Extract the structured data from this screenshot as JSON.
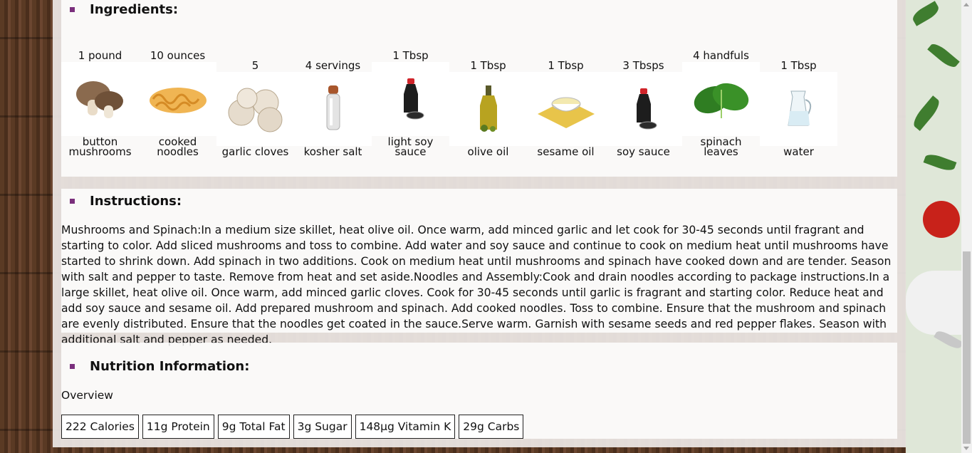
{
  "ingredients": {
    "title": "Ingredients:",
    "items": [
      {
        "qty": "1 pound",
        "name_line1": "button",
        "name_line2": "mushrooms",
        "icon": "mushroom-icon"
      },
      {
        "qty": "10 ounces",
        "name_line1": "cooked",
        "name_line2": "noodles",
        "icon": "noodles-icon"
      },
      {
        "qty": "5",
        "name_line1": "garlic cloves",
        "name_line2": "",
        "icon": "garlic-icon"
      },
      {
        "qty": "4 servings",
        "name_line1": "kosher salt",
        "name_line2": "",
        "icon": "salt-grinder-icon"
      },
      {
        "qty": "1 Tbsp",
        "name_line1": "light soy",
        "name_line2": "sauce",
        "icon": "soy-sauce-bottle-icon"
      },
      {
        "qty": "1 Tbsp",
        "name_line1": "olive oil",
        "name_line2": "",
        "icon": "olive-oil-bottle-icon"
      },
      {
        "qty": "1 Tbsp",
        "name_line1": "sesame oil",
        "name_line2": "",
        "icon": "sesame-oil-bowl-icon"
      },
      {
        "qty": "3 Tbsps",
        "name_line1": "soy sauce",
        "name_line2": "",
        "icon": "soy-sauce-bottle-icon"
      },
      {
        "qty": "4 handfuls",
        "name_line1": "spinach",
        "name_line2": "leaves",
        "icon": "spinach-icon"
      },
      {
        "qty": "1 Tbsp",
        "name_line1": "water",
        "name_line2": "",
        "icon": "water-jug-icon"
      }
    ]
  },
  "instructions": {
    "title": "Instructions:",
    "text": "Mushrooms and Spinach:In a medium size skillet, heat olive oil. Once warm, add minced garlic and let cook for 30-45 seconds until fragrant and starting to color. Add sliced mushrooms and toss to combine. Add water and soy sauce and continue to cook on medium heat until mushrooms have started to shrink down. Add spinach in two additions. Cook on medium heat until mushrooms and spinach have cooked down and are tender. Season with salt and pepper to taste. Remove from heat and set aside.Noodles and Assembly:Cook and drain noodles according to package instructions.In a large skillet, heat olive oil. Once warm, add minced garlic cloves. Cook for 30-45 seconds until garlic is fragrant and starting color. Reduce heat and add soy sauce and sesame oil. Add prepared mushroom and spinach. Add cooked noodles. Toss to combine. Ensure that the mushroom and spinach are evenly distributed. Ensure that the noodles get coated in the sauce.Serve warm. Garnish with sesame seeds and red pepper flakes. Season with additional salt and pepper as needed."
  },
  "nutrition": {
    "title": "Nutrition Information:",
    "overview_label": "Overview",
    "chips": [
      "222 Calories",
      "11g Protein",
      "9g Total Fat",
      "3g Sugar",
      "148µg Vitamin K",
      "29g Carbs"
    ]
  },
  "colors": {
    "bullet": "#7a2f7c",
    "panel_bg": "#ffffff",
    "container_bg": "#eee8e6",
    "wood": "#5a3a24"
  }
}
